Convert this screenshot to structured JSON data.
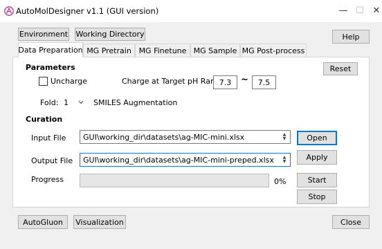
{
  "window": {
    "title": "AutoMolDesigner v1.1 (GUI version)",
    "controls": {
      "minimize": "—",
      "maximize": "☐",
      "close": "✕"
    }
  },
  "toolbar": {
    "environment": "Environment",
    "working_directory": "Working Directory",
    "help": "Help"
  },
  "tabs": [
    {
      "label": "Data Preparation",
      "active": true
    },
    {
      "label": "MG Pretrain",
      "active": false
    },
    {
      "label": "MG Finetune",
      "active": false
    },
    {
      "label": "MG Sample",
      "active": false
    },
    {
      "label": "MG Post-process",
      "active": false
    }
  ],
  "parameters": {
    "heading": "Parameters",
    "reset": "Reset",
    "uncharge_label": "Uncharge",
    "uncharge_checked": false,
    "ph_label": "Charge at Target pH Range:",
    "ph_min": "7.3",
    "ph_sep": "~",
    "ph_max": "7.5",
    "fold_label": "Fold:",
    "fold_value": "1",
    "smiles_aug": "SMILES Augmentation"
  },
  "curation": {
    "heading": "Curation",
    "input_label": "Input File",
    "input_value": "GUI\\working_dir\\datasets\\ag-MIC-mini.xlsx",
    "open": "Open",
    "output_label": "Output File",
    "output_value": "GUI\\working_dir\\datasets\\ag-MIC-mini-preped.xlsx",
    "apply": "Apply",
    "progress_label": "Progress",
    "progress_fraction": 0,
    "progress_text": "0%",
    "start": "Start",
    "stop": "Stop"
  },
  "footer": {
    "autogluon": "AutoGluon",
    "visualization": "Visualization",
    "close": "Close"
  },
  "colors": {
    "accent": "#0078d7",
    "app_icon": "#b03a8a"
  }
}
